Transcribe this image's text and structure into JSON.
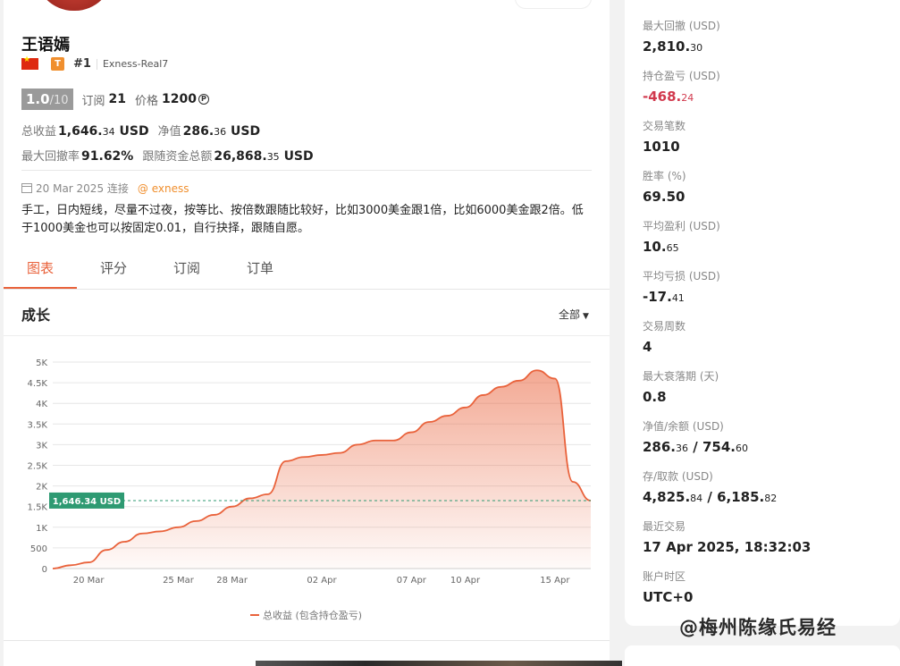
{
  "profile": {
    "name": "王语嫣",
    "tier_badge": "T",
    "rank": "#1",
    "account": "Exness-Real7",
    "rating_score": "1.0",
    "rating_max": "/10",
    "subs_label": "订阅",
    "subs_value": "21",
    "price_label": "价格",
    "price_value": "1200",
    "price_coin": "P"
  },
  "stats": {
    "total_label": "总收益",
    "total_int": "1,646.",
    "total_dec": "34",
    "total_unit": "USD",
    "equity_label": "净值",
    "equity_int": "286.",
    "equity_dec": "36",
    "equity_unit": "USD",
    "drawdown_label": "最大回撤率",
    "drawdown_value": "91.62%",
    "follow_label": "跟随资金总额",
    "follow_int": "26,868.",
    "follow_dec": "35",
    "follow_unit": "USD"
  },
  "connect": {
    "date": "20 Mar 2025 连接",
    "broker": "@ exness"
  },
  "description": "手工，日内短线，尽量不过夜，按等比、按倍数跟随比较好，比如3000美金跟1倍，比如6000美金跟2倍。低于1000美金也可以按固定0.01，自行抉择，跟随自愿。",
  "tabs": [
    "图表",
    "评分",
    "订阅",
    "订单"
  ],
  "growth": {
    "title": "成长",
    "range": "全部",
    "marker": "1,646.34 USD",
    "legend": "总收益 (包含持仓盈亏)"
  },
  "chart_data": {
    "type": "area",
    "x": [
      "18 Mar",
      "19 Mar",
      "20 Mar",
      "21 Mar",
      "22 Mar",
      "23 Mar",
      "24 Mar",
      "25 Mar",
      "26 Mar",
      "27 Mar",
      "28 Mar",
      "29 Mar",
      "30 Mar",
      "31 Mar",
      "01 Apr",
      "02 Apr",
      "03 Apr",
      "04 Apr",
      "05 Apr",
      "06 Apr",
      "07 Apr",
      "08 Apr",
      "09 Apr",
      "10 Apr",
      "11 Apr",
      "12 Apr",
      "13 Apr",
      "14 Apr",
      "15 Apr",
      "16 Apr",
      "17 Apr"
    ],
    "y": [
      0,
      80,
      150,
      450,
      650,
      850,
      900,
      1000,
      1150,
      1300,
      1500,
      1700,
      1800,
      2600,
      2700,
      2750,
      2800,
      3000,
      3100,
      3100,
      3300,
      3550,
      3700,
      3900,
      4200,
      4400,
      4550,
      4800,
      4600,
      2100,
      1646.34
    ],
    "xticks": [
      "20 Mar",
      "25 Mar",
      "28 Mar",
      "02 Apr",
      "07 Apr",
      "10 Apr",
      "15 Apr"
    ],
    "xtick_index": [
      2,
      7,
      10,
      15,
      20,
      23,
      28
    ],
    "yticks": [
      "0",
      "500",
      "1K",
      "1.5K",
      "2K",
      "2.5K",
      "3K",
      "3.5K",
      "4K",
      "4.5K",
      "5K"
    ],
    "ylim": [
      0,
      5000
    ],
    "reference_value": 1646.34,
    "grid": true,
    "legend": "bottom-center",
    "colors": {
      "line": "#e9623b",
      "marker": "#2e9a72"
    }
  },
  "right_stats": [
    {
      "label": "最大回撤 (USD)",
      "int": "2,810.",
      "dec": "30"
    },
    {
      "label": "持仓盈亏 (USD)",
      "int": "-468.",
      "dec": "24",
      "negative": true
    },
    {
      "label": "交易笔数",
      "int": "1010",
      "dec": ""
    },
    {
      "label": "胜率 (%)",
      "int": "69.50",
      "dec": ""
    },
    {
      "label": "平均盈利 (USD)",
      "int": "10.",
      "dec": "65"
    },
    {
      "label": "平均亏损 (USD)",
      "int": "-17.",
      "dec": "41"
    },
    {
      "label": "交易周数",
      "int": "4",
      "dec": ""
    },
    {
      "label": "最大衰落期 (天)",
      "int": "0.8",
      "dec": ""
    },
    {
      "label": "净值/余额 (USD)",
      "int": "286.",
      "dec": "36",
      "int2": "754.",
      "dec2": "60"
    },
    {
      "label": "存/取款 (USD)",
      "int": "4,825.",
      "dec": "84",
      "int2": "6,185.",
      "dec2": "82"
    },
    {
      "label": "最近交易",
      "int": "17 Apr 2025, 18:32:03",
      "dec": ""
    },
    {
      "label": "账户时区",
      "int": "UTC+0",
      "dec": ""
    }
  ],
  "watermark": "@梅州陈缘氏易经",
  "colors": {
    "accent": "#e9623b",
    "negative": "#d1394d"
  }
}
